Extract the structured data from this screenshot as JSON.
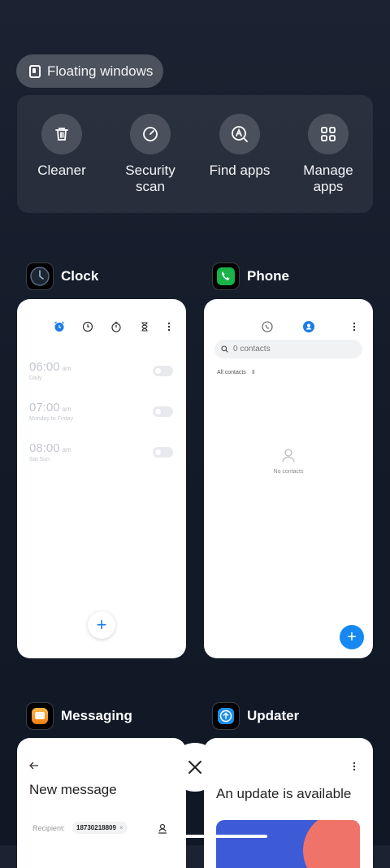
{
  "floating_windows": {
    "label": "Floating windows",
    "icon": "floating-window-icon"
  },
  "quick_actions": [
    {
      "label": "Cleaner",
      "icon": "trash-icon"
    },
    {
      "label": "Security\nscan",
      "icon": "security-scan-icon"
    },
    {
      "label": "Find apps",
      "icon": "find-apps-icon"
    },
    {
      "label": "Manage\napps",
      "icon": "grid-icon"
    }
  ],
  "apps": {
    "clock": {
      "title": "Clock",
      "alarms": [
        {
          "time": "06:00",
          "ampm": "am",
          "repeat": "Daily"
        },
        {
          "time": "07:00",
          "ampm": "am",
          "repeat": "Monday to Friday"
        },
        {
          "time": "08:00",
          "ampm": "am",
          "repeat": "Sat Sun"
        }
      ],
      "fab": "+"
    },
    "phone": {
      "title": "Phone",
      "search_placeholder": "0 contacts",
      "filter": "All contacts",
      "empty_text": "No contacts",
      "fab": "+"
    },
    "messaging": {
      "title": "Messaging",
      "heading": "New message",
      "recipient_label": "Recipient:",
      "recipient_chip": "18730218809"
    },
    "updater": {
      "title": "Updater",
      "heading": "An update is available"
    }
  },
  "colors": {
    "accent_blue": "#1688f2",
    "background_top": "#1b2332",
    "background_bottom": "#101826"
  }
}
